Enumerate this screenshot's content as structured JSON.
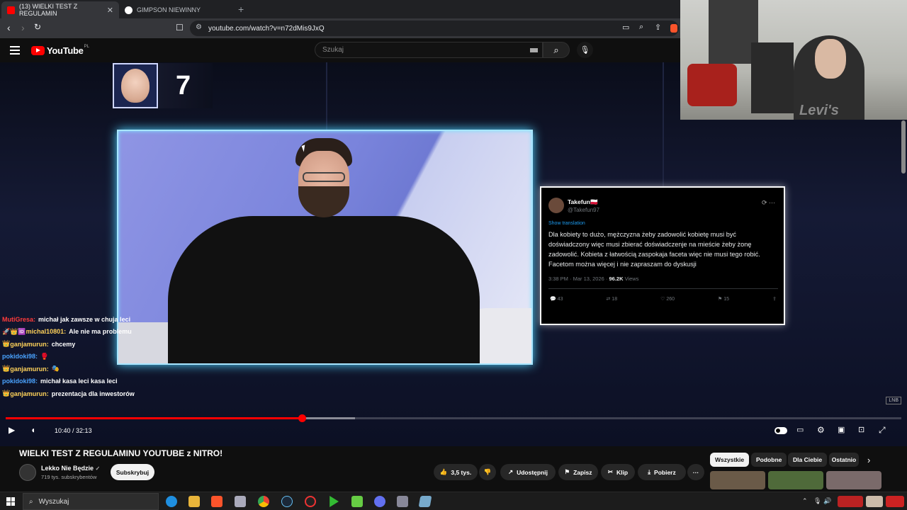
{
  "browser": {
    "tabs": [
      {
        "label": "(13) WIELKI TEST Z REGULAMIN",
        "close": "✕",
        "active": true
      },
      {
        "label": "GIMPSON NIEWINNY",
        "active": false
      }
    ],
    "new_tab": "+",
    "url": "youtube.com/watch?v=n72dMis9JxQ"
  },
  "youtube": {
    "logo": "YouTube",
    "country": "PL",
    "search_placeholder": "Szukaj"
  },
  "overlay": {
    "score": "7",
    "tweet": {
      "name": "Takefun🇵🇱",
      "handle": "@Takefun97",
      "translation": "Show translation",
      "text": "Dla kobiety to dużo, mężczyzna żeby zadowolić kobietę musi być doświadczony więc musi zbierać doświadczenje na mieście żeby żonę zadowolić. Kobieta z łatwością zaspokaja faceta więc nie musi tego robić.  Facetom można więcej i nie zapraszam do dyskusji",
      "time": "3:38 PM · Mar 13, 2026 · ",
      "views": "96.2K",
      "views_label": " Views",
      "replies": "43",
      "retweets": "18",
      "likes": "260",
      "bookmarks": "15"
    },
    "chat": [
      {
        "user": "MutiGresa:",
        "msg": "michał jak zawsze w chuja leci",
        "color": "#ff3b3b"
      },
      {
        "user": "michal10801:",
        "msg": "Ale nie ma problemu",
        "color": "#ffd25a",
        "badges": "🚀👑🆔"
      },
      {
        "user": "ganjamurun:",
        "msg": "chcemy",
        "color": "#ffd25a",
        "badges": "👑"
      },
      {
        "user": "pokidoki98:",
        "msg": "🥊",
        "color": "#4aa3ff"
      },
      {
        "user": "ganjamurun:",
        "msg": "🎭",
        "color": "#ffd25a",
        "badges": "👑"
      },
      {
        "user": "pokidoki98:",
        "msg": "michał kasa leci kasa leci",
        "color": "#4aa3ff"
      },
      {
        "user": "ganjamurun:",
        "msg": "prezentacja dla inwestorów",
        "color": "#ffd25a",
        "badges": "👑"
      }
    ]
  },
  "player": {
    "time_current": "10:40",
    "time_sep": " / ",
    "time_total": "32:13",
    "progress": 0.331,
    "buffered": 0.39
  },
  "video": {
    "title": "WIELKI TEST Z REGULAMINU YOUTUBE z NITRO!",
    "channel": "Lekko Nie Będzie",
    "verified": "✓",
    "subscribers": "719 tys. subskrybentów",
    "subscribe": "Subskrybuj",
    "likes": "3,5 tys.",
    "share": "Udostępnij",
    "save": "Zapisz",
    "clip": "Klip",
    "download": "Pobierz",
    "more": "···"
  },
  "chips": [
    "Wszystkie",
    "Podobne",
    "Dla Ciebie",
    "Ostatnio"
  ],
  "taskbar": {
    "search": "Wyszukaj"
  },
  "colors": {
    "accent": "#ff0000",
    "frame_glow": "#4fd3ff",
    "twitter_blue": "#1d9bf0"
  }
}
